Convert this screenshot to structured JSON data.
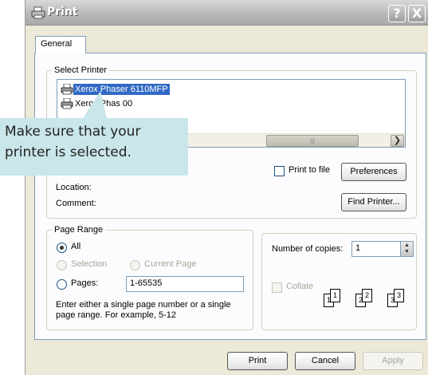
{
  "window": {
    "title": "Print",
    "help_button": "?",
    "close_button": "X"
  },
  "tabs": [
    {
      "label": "General"
    }
  ],
  "select_printer": {
    "legend": "Select Printer",
    "printers": [
      {
        "name": "Xerox Phaser 6110MFP",
        "selected": true
      },
      {
        "name": "Xerox Phas   00",
        "selected": false
      }
    ],
    "print_to_file_label": "Print to file",
    "preferences_button": "Preferences",
    "location_label": "Location:",
    "comment_label": "Comment:",
    "find_printer_button": "Find Printer..."
  },
  "callout": {
    "line1": "Make sure that your",
    "line2": "printer is selected."
  },
  "page_range": {
    "legend": "Page Range",
    "all_label": "All",
    "selection_label": "Selection",
    "current_page_label": "Current Page",
    "pages_label": "Pages:",
    "pages_value": "1-65535",
    "help_text_line1": "Enter either a single page number or a single",
    "help_text_line2": "page range.  For example, 5-12"
  },
  "copies": {
    "number_of_copies_label": "Number of copies:",
    "copies_value": "1",
    "collate_label": "Collate",
    "collate_pages": [
      "1",
      "1",
      "2",
      "2",
      "3",
      "3"
    ]
  },
  "footer": {
    "print_button": "Print",
    "cancel_button": "Cancel",
    "apply_button": "Apply"
  }
}
